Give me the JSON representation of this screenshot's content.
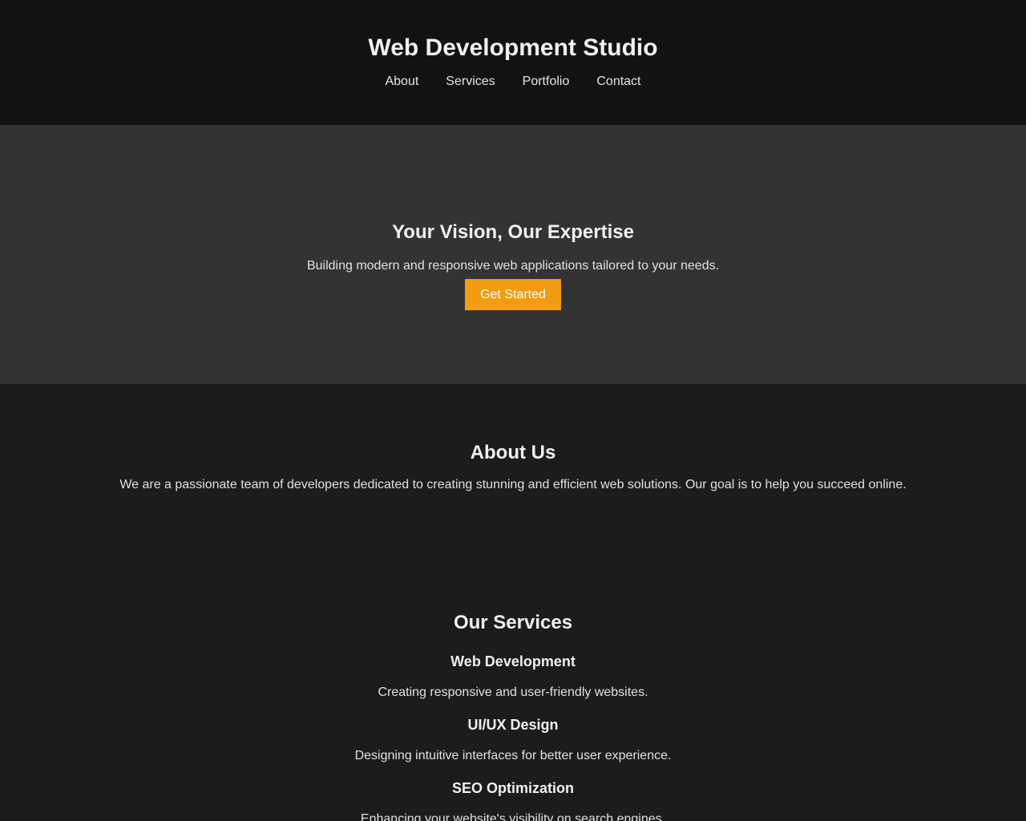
{
  "header": {
    "title": "Web Development Studio",
    "nav": [
      "About",
      "Services",
      "Portfolio",
      "Contact"
    ]
  },
  "hero": {
    "title": "Your Vision, Our Expertise",
    "subtitle": "Building modern and responsive web applications tailored to your needs.",
    "cta_label": "Get Started",
    "cta_color": "#f39c12"
  },
  "about": {
    "title": "About Us",
    "text": "We are a passionate team of developers dedicated to creating stunning and efficient web solutions. Our goal is to help you succeed online."
  },
  "services": {
    "title": "Our Services",
    "items": [
      {
        "title": "Web Development",
        "desc": "Creating responsive and user-friendly websites."
      },
      {
        "title": "UI/UX Design",
        "desc": "Designing intuitive interfaces for better user experience."
      },
      {
        "title": "SEO Optimization",
        "desc": "Enhancing your website's visibility on search engines."
      }
    ]
  }
}
